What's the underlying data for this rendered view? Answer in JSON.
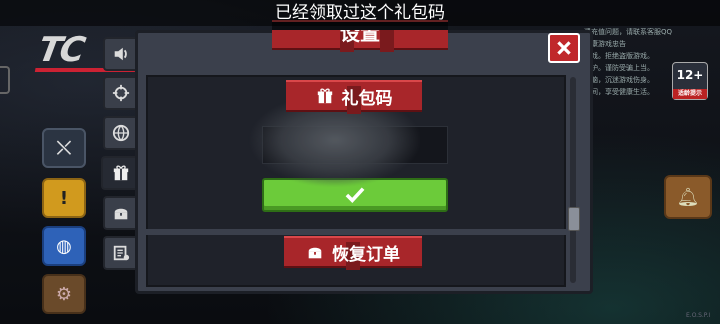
{
  "toast": {
    "text": "已经领取过这个礼包码"
  },
  "dialog": {
    "title": "设置",
    "gift_section_label": "礼包码",
    "restore_section_label": "恢复订单",
    "code_input_value": "",
    "confirm_icon": "checkmark-icon",
    "close_icon": "close-icon"
  },
  "side_tabs": [
    {
      "icon": "speaker-icon",
      "active": false
    },
    {
      "icon": "crosshair-icon",
      "active": false
    },
    {
      "icon": "globe-icon",
      "active": false
    },
    {
      "icon": "gift-icon",
      "active": true
    },
    {
      "icon": "chest-icon",
      "active": false
    },
    {
      "icon": "settings-list-icon",
      "active": false
    }
  ],
  "background": {
    "right_notice": [
      "遇充值问题，请联系客服QQ",
      "健康游戏忠告",
      "游戏。拒绝盗版游戏。",
      "保护。谨防受骗上当。",
      "益脑，沉迷游戏伤身。",
      "时间，享受健康生活。"
    ],
    "age_badge": "12+",
    "age_badge_sub": "适龄提示",
    "watermark": "E.O.S.P.I"
  },
  "colors": {
    "ribbon_red": "#a8262a",
    "confirm_green": "#6ccb3a",
    "close_red": "#c0282b",
    "panel_gray": "#3b404c"
  }
}
